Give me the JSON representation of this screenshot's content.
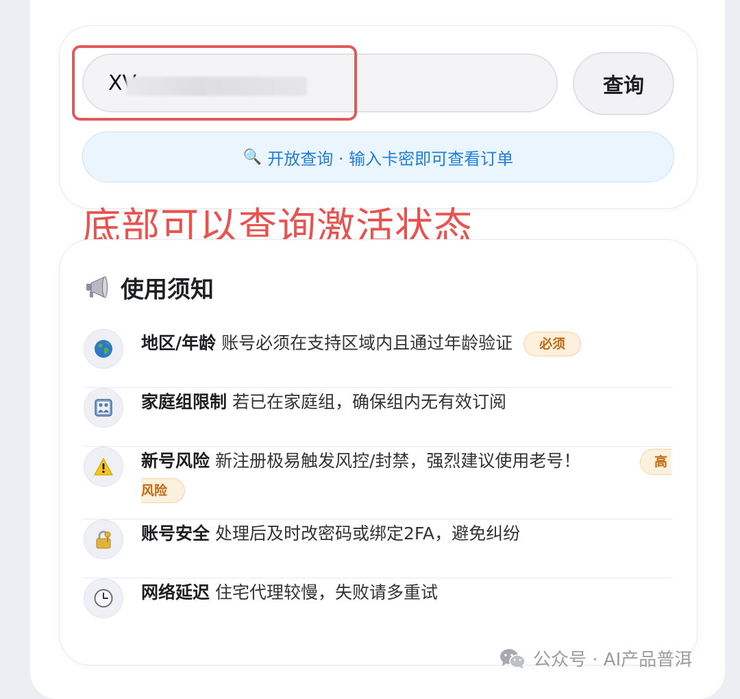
{
  "search": {
    "value": "XV",
    "query_button": "查询",
    "open_query_icon": "magnifier-icon",
    "open_query_text": "开放查询 · 输入卡密即可查看订单"
  },
  "annotation": {
    "text": "底部可以查询激活状态",
    "color": "#e8524f",
    "box_color": "#e05a5a"
  },
  "notice": {
    "icon": "megaphone-icon",
    "title": "使用须知",
    "items": [
      {
        "icon": "globe-icon",
        "label": "地区/年龄",
        "text": "账号必须在支持区域内且通过年龄验证",
        "badge": "必须"
      },
      {
        "icon": "family-icon",
        "label": "家庭组限制",
        "text": "若已在家庭组，确保组内无有效订阅"
      },
      {
        "icon": "warning-icon",
        "label": "新号风险",
        "text": "新注册极易触发风控/封禁，强烈建议使用老号！",
        "badge_part1": "高",
        "badge_part2": "风险"
      },
      {
        "icon": "lock-key-icon",
        "label": "账号安全",
        "text": "处理后及时改密码或绑定2FA，避免纠纷"
      },
      {
        "icon": "clock-icon",
        "label": "网络延迟",
        "text": "住宅代理较慢，失败请多重试"
      }
    ]
  },
  "watermark": {
    "icon": "wechat-icon",
    "text": "公众号 · AI产品普洱"
  },
  "colors": {
    "link_blue": "#1f7fd8",
    "badge_text": "#c2680f",
    "badge_bg": "#fdf0dc"
  }
}
